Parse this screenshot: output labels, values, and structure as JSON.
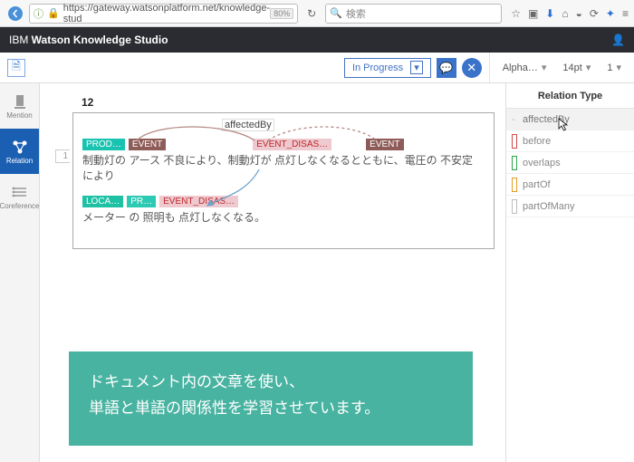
{
  "browser": {
    "url": "https://gateway.watsonplatform.net/knowledge-stud",
    "zoom": "80%",
    "search_placeholder": "検索"
  },
  "app": {
    "title_prefix": "IBM ",
    "title_bold": "Watson Knowledge Studio"
  },
  "toolbar": {
    "status": "In Progress",
    "sort": "Alpha…",
    "fontsize": "14pt",
    "page": "1"
  },
  "side": {
    "mention": "Mention",
    "relation": "Relation",
    "coreference": "Coreference"
  },
  "doc": {
    "number": "12",
    "line": "1",
    "relation_label": "affectedBy",
    "row1": {
      "t1": "PROD…",
      "t2": "EVENT",
      "t3": "EVENT_DISAS…",
      "t4": "EVENT"
    },
    "sentence1": "制動灯の アース 不良により、制動灯が 点灯しなくなるとともに、電圧の 不安定 により",
    "row2": {
      "t1": "LOCA…",
      "t2": "PR…",
      "t3": "EVENT_DISAS…"
    },
    "sentence2": "メーター の 照明も 点灯しなくなる。"
  },
  "right": {
    "heading": "Relation Type",
    "items": [
      {
        "label": "affectedBy",
        "sw": "dash",
        "selected": true
      },
      {
        "label": "before",
        "sw": "red",
        "selected": false
      },
      {
        "label": "overlaps",
        "sw": "green",
        "selected": false
      },
      {
        "label": "partOf",
        "sw": "orange",
        "selected": false
      },
      {
        "label": "partOfMany",
        "sw": "gray",
        "selected": false
      }
    ]
  },
  "overlay": {
    "line1": "ドキュメント内の文章を使い、",
    "line2": "単語と単語の関係性を学習させています。"
  }
}
